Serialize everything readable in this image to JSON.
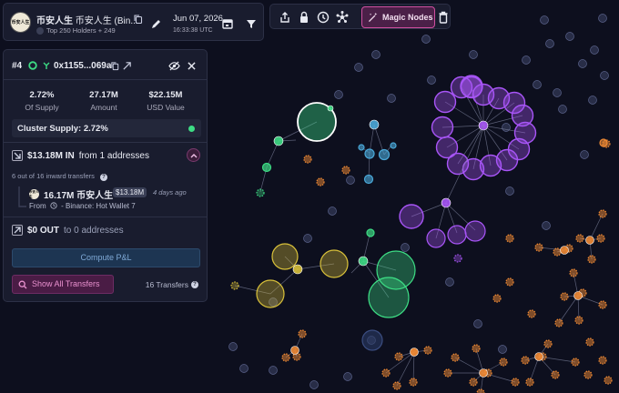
{
  "token": {
    "logo_text": "币安人生",
    "name": "币安人生",
    "name_sub": "币安人生 (Bin...",
    "holders": "Top 250 Holders + 249",
    "date": "Jun 07, 2026",
    "time": "16:33:38 UTC"
  },
  "toolbar": {
    "magic_nodes_label": "Magic Nodes",
    "icons": [
      "share-icon",
      "lock-icon",
      "clock-icon",
      "network-icon",
      "magic-wand-icon",
      "trash-icon"
    ]
  },
  "detail": {
    "rank": "#4",
    "address": "0x1155...069a",
    "stats": [
      {
        "value": "2.72%",
        "label": "Of Supply"
      },
      {
        "value": "27.17M",
        "label": "Amount"
      },
      {
        "value": "$22.15M",
        "label": "USD Value"
      }
    ],
    "cluster_supply": "Cluster Supply: 2.72%",
    "inflow": {
      "amount": "$13.18M IN",
      "from": "from 1 addresses"
    },
    "transfers_note": "6 out of 16 inward transfers",
    "transfer": {
      "logo_text": "币安人生",
      "amount": "16.17M 币安人生",
      "usd": "$13.18M",
      "ago": "4 days ago",
      "from": "From",
      "source": "Binance: Hot Wallet 7"
    },
    "outflow": {
      "amount": "$0 OUT",
      "to": "to 0 addresses"
    },
    "compute_pnl": "Compute P&L",
    "show_all": "Show All Transfers",
    "transfer_count": "16 Transfers"
  },
  "colors": {
    "background": "#0d0f1e",
    "panel": "#1a1d2e",
    "green_cluster": "#3ddc84",
    "purple_cluster": "#a855f7",
    "yellow_cluster": "#d9c13a",
    "orange_cluster": "#f08a34",
    "blue_cluster": "#4aa8d8",
    "accent_pink": "#d04fa0"
  }
}
